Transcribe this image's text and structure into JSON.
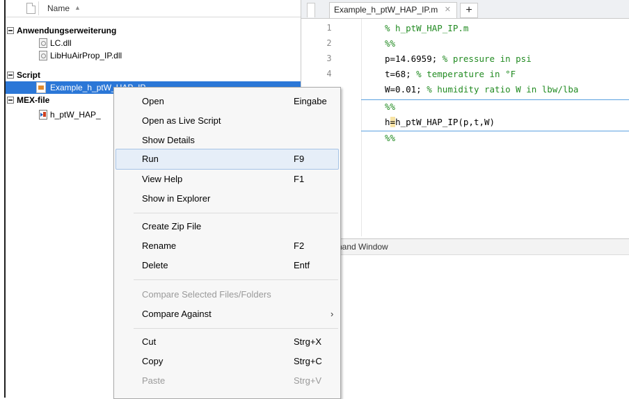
{
  "browser": {
    "header_label": "Name",
    "sort_glyph": "▲",
    "groups": [
      {
        "label": "Anwendungserweiterung",
        "files": [
          "LC.dll",
          "LibHuAirProp_IP.dll"
        ]
      },
      {
        "label": "Script",
        "files": [
          "Example_h_ptW_HAP_IP"
        ]
      },
      {
        "label": "MEX-file",
        "files": [
          "h_ptW_HAP_"
        ]
      }
    ]
  },
  "editor": {
    "tab_title": "Example_h_ptW_HAP_IP.m",
    "tab_close": "✕",
    "new_tab": "+",
    "line_numbers": [
      "1",
      "2",
      "3",
      "4"
    ],
    "lines": {
      "l1_comment": "% h_ptW_HAP_IP.m",
      "l2_section": "%%",
      "l3_code": "p=14.6959; ",
      "l3_comment": "% pressure in psi",
      "l4_code": "t=68; ",
      "l4_comment": "% temperature in °F",
      "l5_code": "W=0.01; ",
      "l5_comment": "% humidity ratio W in lbw/lba",
      "l6_section": "%%",
      "l7_pre": "h",
      "l7_cursor": "=",
      "l7_post": "h_ptW_HAP_IP(p,t,W)",
      "l8_section": "%%"
    },
    "command_window_label": "hand Window"
  },
  "context_menu": {
    "items": [
      {
        "label": "Open",
        "shortcut": "Eingabe"
      },
      {
        "label": "Open as Live Script",
        "shortcut": ""
      },
      {
        "label": "Show Details",
        "shortcut": ""
      },
      {
        "label": "Run",
        "shortcut": "F9"
      },
      {
        "label": "View Help",
        "shortcut": "F1"
      },
      {
        "label": "Show in Explorer",
        "shortcut": ""
      },
      {
        "label": "Create Zip File",
        "shortcut": ""
      },
      {
        "label": "Rename",
        "shortcut": "F2"
      },
      {
        "label": "Delete",
        "shortcut": "Entf"
      },
      {
        "label": "Compare Selected Files/Folders",
        "shortcut": ""
      },
      {
        "label": "Compare Against",
        "shortcut": ""
      },
      {
        "label": "Cut",
        "shortcut": "Strg+X"
      },
      {
        "label": "Copy",
        "shortcut": "Strg+C"
      },
      {
        "label": "Paste",
        "shortcut": "Strg+V"
      }
    ],
    "submenu_arrow": "›"
  },
  "colors": {
    "selection_blue": "#2b77d7",
    "comment_green": "#228b22",
    "menu_highlight": "#e6eef8",
    "disabled_text": "#9a9a9a"
  }
}
